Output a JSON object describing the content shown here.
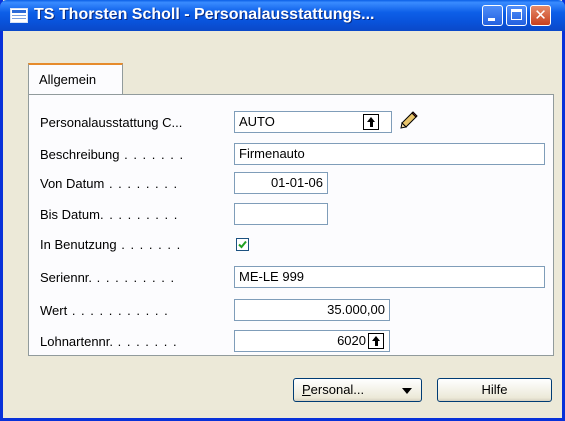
{
  "window": {
    "title": "TS Thorsten Scholl - Personalausstattungs...",
    "minimize_glyph": "",
    "close_glyph": "✕"
  },
  "tabs": [
    {
      "label": "Allgemein",
      "active": true
    }
  ],
  "fields": {
    "personalausstattung": {
      "label": "Personalausstattung C...",
      "value": "AUTO"
    },
    "beschreibung": {
      "label": "Beschreibung",
      "leader": " . . . . . . .",
      "value": "Firmenauto"
    },
    "von_datum": {
      "label": "Von Datum",
      "leader": " . . . . . . . .",
      "value": "01-01-06"
    },
    "bis_datum": {
      "label": "Bis Datum",
      "leader": ". . . . . . . . .",
      "value": ""
    },
    "in_benutzung": {
      "label": "In Benutzung",
      "leader": " . . . . . . .",
      "checked": true
    },
    "seriennr": {
      "label": "Seriennr.",
      "leader": " . . . . . . . . .",
      "value": "ME-LE 999"
    },
    "wert": {
      "label": "Wert",
      "leader": " . . . . . . . . . . .",
      "value": "35.000,00"
    },
    "lohnartennr": {
      "label": "Lohnartennr.",
      "leader": " . . . . . . .",
      "value": "6020"
    }
  },
  "buttons": {
    "personal": "Personal...",
    "hilfe": "Hilfe"
  },
  "icons": {
    "app": "table-window-icon",
    "lookup": "lookup-arrow-icon",
    "edit": "pencil-icon",
    "check": "checkmark-icon"
  },
  "colors": {
    "titlebar": "#0a5fe6",
    "window_bg": "#ece9d8",
    "tab_accent": "#e68b2c",
    "field_border": "#7f9db9",
    "check": "#21a121"
  }
}
